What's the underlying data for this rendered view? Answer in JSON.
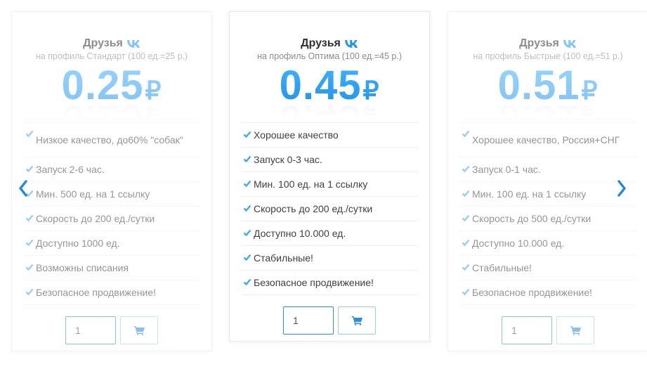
{
  "colors": {
    "accent": "#2196f3",
    "check": "#40a8f0",
    "border": "#eceef1"
  },
  "nav": {
    "prev_icon": "chevron-left-icon",
    "next_icon": "chevron-right-icon"
  },
  "cards": [
    {
      "title": "Друзья",
      "subtitle": "на профиль Стандарт (100 ед.=25 р.)",
      "price": "0.25",
      "currency": "₽",
      "features": [
        "Низкое качество, до60% \"собак\"",
        "Запуск 2-6 час.",
        "Мин. 500 ед. на 1 ссылку",
        "Скорость до 200 ед./сутки",
        "Доступно 1000 ед.",
        "Возможны списания",
        "Безопасное продвижение!"
      ],
      "quantity": "1"
    },
    {
      "title": "Друзья",
      "subtitle": "на профиль Оптима (100 ед.=45 р.)",
      "price": "0.45",
      "currency": "₽",
      "features": [
        "Хорошее качество",
        "Запуск 0-3 час.",
        "Мин. 100 ед. на 1 ссылку",
        "Скорость до 200 ед./сутки",
        "Доступно 10.000 ед.",
        "Стабильные!",
        "Безопасное продвижение!"
      ],
      "quantity": "1"
    },
    {
      "title": "Друзья",
      "subtitle": "на профиль Быстрые (100 ед.=51 р.)",
      "price": "0.51",
      "currency": "₽",
      "features": [
        "Хорошее качество, Россия+СНГ",
        "Запуск 0-1 час.",
        "Мин. 100 ед. на 1 ссылку",
        "Скорость до 500 ед./сутки",
        "Доступно 10.000 ед.",
        "Стабильные!",
        "Безопасное продвижение!"
      ],
      "quantity": "1"
    }
  ]
}
